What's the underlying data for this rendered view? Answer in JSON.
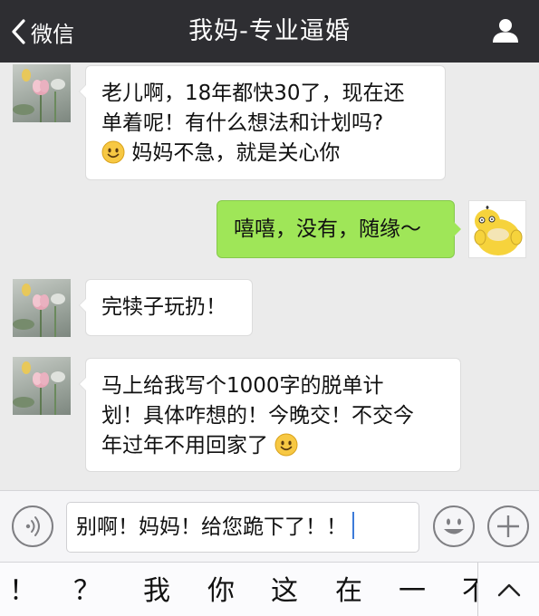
{
  "header": {
    "back_label": "微信",
    "title": "我妈-专业逼婚"
  },
  "messages": [
    {
      "side": "left",
      "lines": [
        "老儿啊，18年都快30了，现在还",
        "单着呢！有什么想法和计划吗?"
      ],
      "emoji_line_text": "妈妈不急，就是关心你"
    },
    {
      "side": "right",
      "text": "嘻嘻，没有，随缘～"
    },
    {
      "side": "left",
      "text": "完犊子玩扔！"
    },
    {
      "side": "left",
      "lines": [
        "马上给我写个1000字的脱单计",
        "划！具体咋想的！今晚交！不交今"
      ],
      "last_line": "年过年不用回家了"
    }
  ],
  "input": {
    "value": "别啊！妈妈！给您跪下了！！"
  },
  "candidates": [
    "！",
    "？",
    "我",
    "你",
    "这",
    "在",
    "一",
    "不"
  ],
  "colors": {
    "header_bg": "#2e2e32",
    "chat_bg": "#ebebeb",
    "sent_bubble": "#9fe658",
    "received_bubble": "#ffffff"
  }
}
